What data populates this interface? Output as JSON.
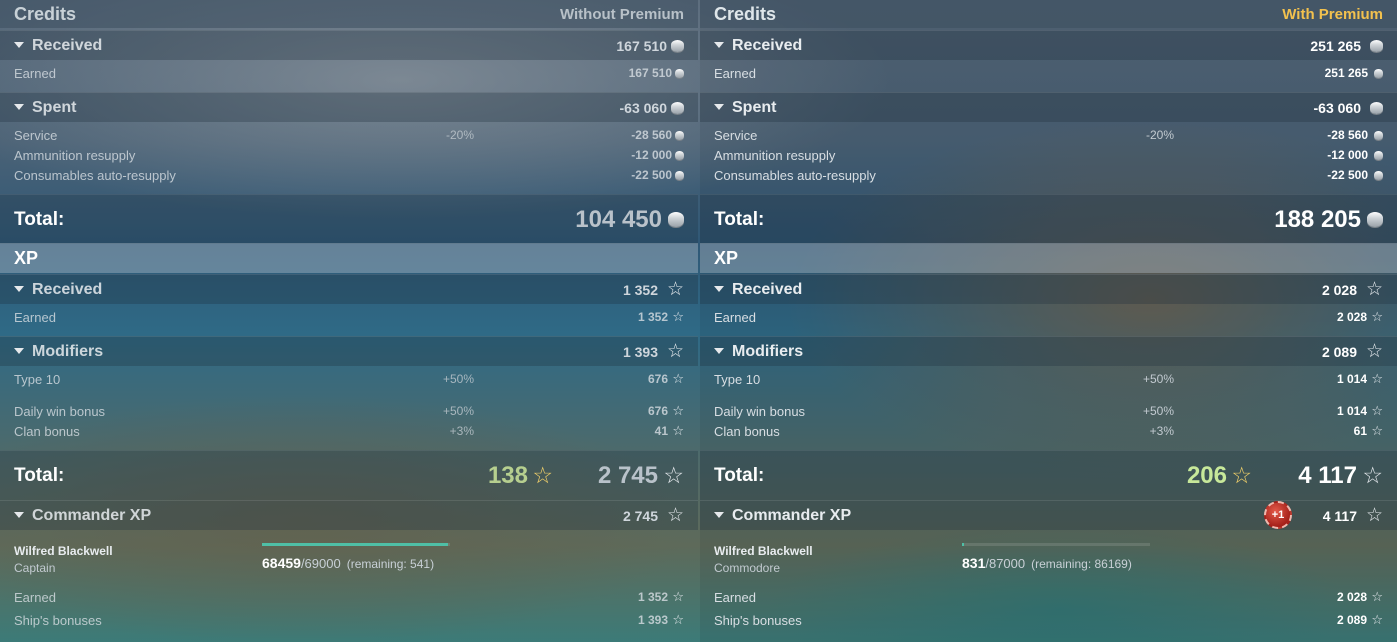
{
  "left": {
    "credits_title": "Credits",
    "mode": "Without Premium",
    "received": {
      "label": "Received",
      "value": "167 510"
    },
    "earned": {
      "label": "Earned",
      "value": "167 510"
    },
    "spent": {
      "label": "Spent",
      "value": "-63 060"
    },
    "service": {
      "label": "Service",
      "pct": "-20%",
      "value": "-28 560"
    },
    "ammo": {
      "label": "Ammunition resupply",
      "value": "-12 000"
    },
    "consumables": {
      "label": "Consumables auto-resupply",
      "value": "-22 500"
    },
    "credits_total": {
      "label": "Total:",
      "value": "104 450"
    },
    "xp_title": "XP",
    "xp_received": {
      "label": "Received",
      "value": "1 352"
    },
    "xp_earned": {
      "label": "Earned",
      "value": "1 352"
    },
    "modifiers": {
      "label": "Modifiers",
      "value": "1 393"
    },
    "type10": {
      "label": "Type 10",
      "pct": "+50%",
      "value": "676"
    },
    "daily": {
      "label": "Daily win bonus",
      "pct": "+50%",
      "value": "676"
    },
    "clan": {
      "label": "Clan bonus",
      "pct": "+3%",
      "value": "41"
    },
    "xp_total": {
      "label": "Total:",
      "bonus": "138",
      "value": "2 745"
    },
    "commander": {
      "label": "Commander XP",
      "value": "2 745"
    },
    "captain": {
      "name": "Wilfred Blackwell",
      "rank": "Captain",
      "current": "68459",
      "max": "/69000",
      "remaining": "(remaining: 541)",
      "progress": 0.992
    },
    "cmd_earned": {
      "label": "Earned",
      "value": "1 352"
    },
    "ship_bonuses": {
      "label": "Ship's bonuses",
      "value": "1 393"
    }
  },
  "right": {
    "credits_title": "Credits",
    "mode": "With Premium",
    "received": {
      "label": "Received",
      "value": "251 265"
    },
    "earned": {
      "label": "Earned",
      "value": "251 265"
    },
    "spent": {
      "label": "Spent",
      "value": "-63 060"
    },
    "service": {
      "label": "Service",
      "pct": "-20%",
      "value": "-28 560"
    },
    "ammo": {
      "label": "Ammunition resupply",
      "value": "-12 000"
    },
    "consumables": {
      "label": "Consumables auto-resupply",
      "value": "-22 500"
    },
    "credits_total": {
      "label": "Total:",
      "value": "188 205"
    },
    "xp_title": "XP",
    "xp_received": {
      "label": "Received",
      "value": "2 028"
    },
    "xp_earned": {
      "label": "Earned",
      "value": "2 028"
    },
    "modifiers": {
      "label": "Modifiers",
      "value": "2 089"
    },
    "type10": {
      "label": "Type 10",
      "pct": "+50%",
      "value": "1 014"
    },
    "daily": {
      "label": "Daily win bonus",
      "pct": "+50%",
      "value": "1 014"
    },
    "clan": {
      "label": "Clan bonus",
      "pct": "+3%",
      "value": "61"
    },
    "xp_total": {
      "label": "Total:",
      "bonus": "206",
      "value": "4 117"
    },
    "commander": {
      "label": "Commander XP",
      "value": "4 117",
      "badge": "+1"
    },
    "captain": {
      "name": "Wilfred Blackwell",
      "rank": "Commodore",
      "current": "831",
      "max": "/87000",
      "remaining": "(remaining: 86169)",
      "progress": 0.01
    },
    "cmd_earned": {
      "label": "Earned",
      "value": "2 028"
    },
    "ship_bonuses": {
      "label": "Ship's bonuses",
      "value": "2 089"
    }
  },
  "colors": {
    "premium_accent": "#f2c14e",
    "xp_bonus": "#c7e89a",
    "progress": "#4fbfa6",
    "badge": "#a5211a"
  },
  "icons": {
    "credits": "silver-coin-icon",
    "xp": "star-icon",
    "expand": "caret-down-icon"
  }
}
